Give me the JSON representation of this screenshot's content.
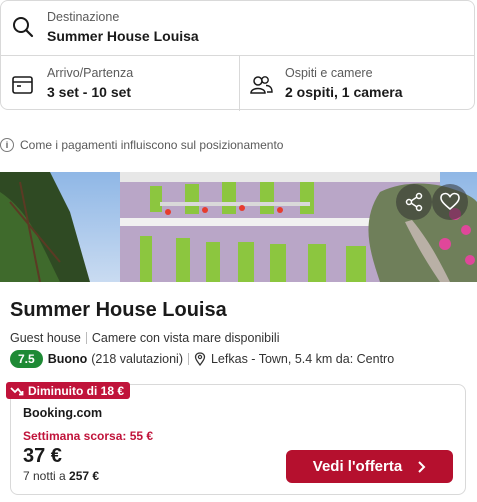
{
  "search": {
    "destination": {
      "label": "Destinazione",
      "value": "Summer House Louisa",
      "icon": "search-icon"
    },
    "dates": {
      "label": "Arrivo/Partenza",
      "value": "3 set - 10 set",
      "icon": "calendar-icon"
    },
    "guests": {
      "label": "Ospiti e camere",
      "value": "2 ospiti, 1 camera",
      "icon": "people-icon"
    }
  },
  "info": {
    "text": "Come i pagamenti influiscono sul posizionamento",
    "icon": "info-icon"
  },
  "hotel": {
    "name": "Summer House Louisa",
    "type": "Guest house",
    "feature": "Camere con vista mare disponibili",
    "score": "7.5",
    "rating_word": "Buono",
    "reviews": "(218 valutazioni)",
    "location": "Lefkas - Town, 5.4 km da: Centro"
  },
  "offer": {
    "badge": "Diminuito di 18 €",
    "provider": "Booking.com",
    "last_week": "Settimana scorsa: 55 €",
    "price": "37 €",
    "nights_prefix": "7 notti a ",
    "nights_total": "257 €",
    "cta": "Vedi l'offerta"
  },
  "colors": {
    "accent": "#b5102e",
    "score": "#1e8a35",
    "badge": "#c0133a"
  }
}
